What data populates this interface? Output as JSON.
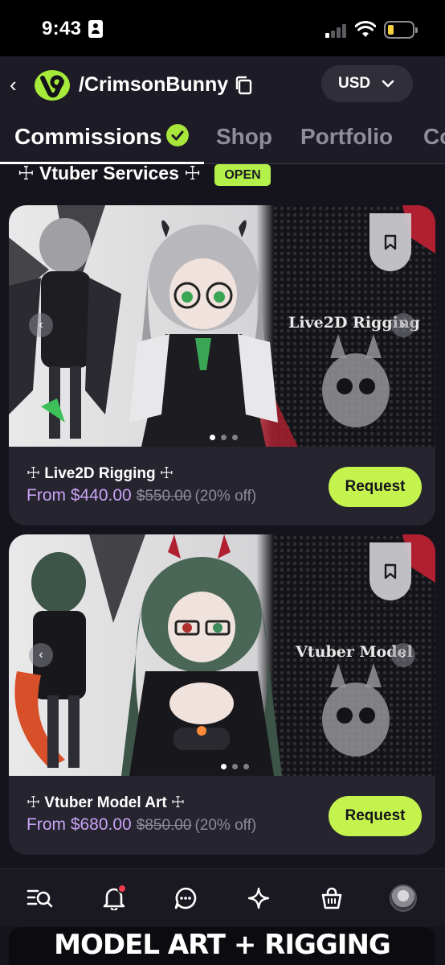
{
  "status_bar": {
    "time": "9:43"
  },
  "header": {
    "profile_name": "/CrimsonBunny",
    "currency": "USD"
  },
  "tabs": [
    {
      "label": "Commissions",
      "active": true
    },
    {
      "label": "Shop",
      "active": false
    },
    {
      "label": "Portfolio",
      "active": false
    },
    {
      "label": "Co",
      "active": false
    }
  ],
  "section": {
    "title": "☩ Vtuber Services ☩",
    "badge": "OPEN"
  },
  "cards": [
    {
      "image_text": "Live2D Rigging",
      "title": "☩ Live2D Rigging ☩",
      "price": "From $440.00",
      "old_price": "$550.00",
      "discount": "(20% off)",
      "button": "Request"
    },
    {
      "image_text": "Vtuber Model",
      "title": "☩ Vtuber Model Art ☩",
      "price": "From $680.00",
      "old_price": "$850.00",
      "discount": "(20% off)",
      "button": "Request"
    }
  ],
  "bottom_nav": [
    "search-list-icon",
    "bell-icon",
    "chat-icon",
    "sparkle-icon",
    "shopping-bag-icon",
    "avatar"
  ],
  "peek_text": "MODEL ART + RIGGING",
  "colors": {
    "accent_green": "#c5f34e",
    "price_purple": "#c9a3f5",
    "background": "#15141c",
    "card": "#25242f"
  }
}
